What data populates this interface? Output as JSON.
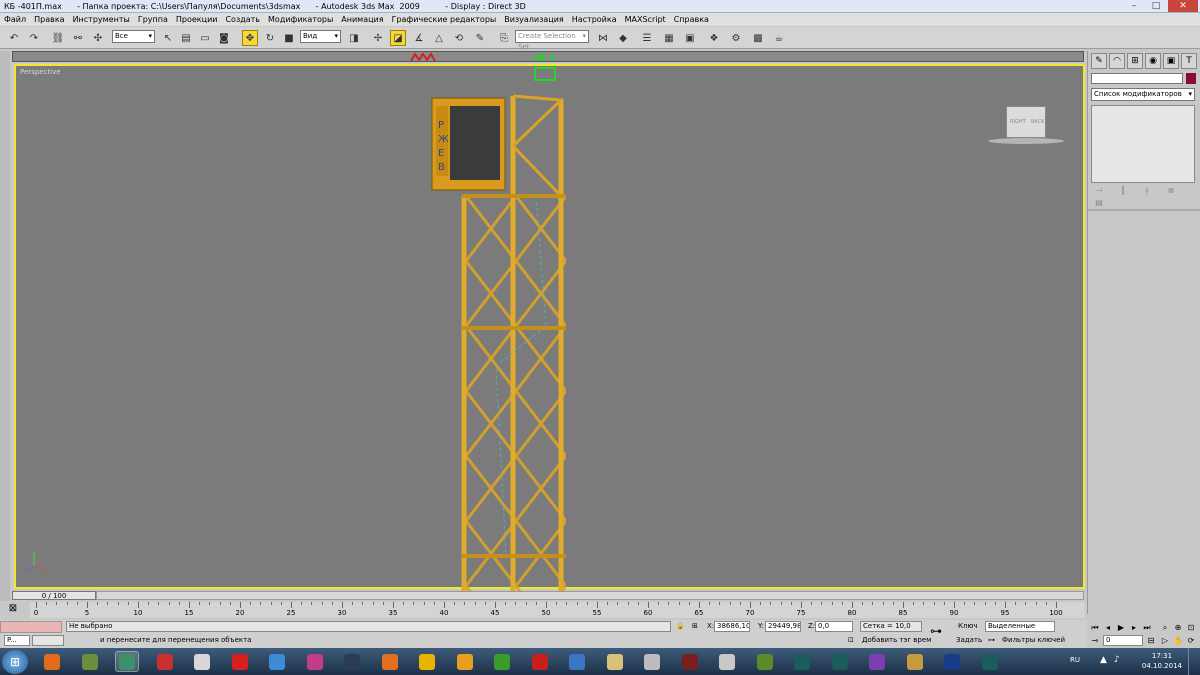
{
  "window": {
    "title": "КБ -401П.max      - Папка проекта: C:\\Users\\Папуля\\Documents\\3dsmax      - Autodesk 3ds Max  2009          - Display : Direct 3D",
    "min": "–",
    "max": "□",
    "close": "✕"
  },
  "menu": [
    "Файл",
    "Правка",
    "Инструменты",
    "Группа",
    "Проекции",
    "Создать",
    "Модификаторы",
    "Анимация",
    "Графические редакторы",
    "Визуализация",
    "Настройка",
    "MAXScript",
    "Справка"
  ],
  "toolbar": {
    "filter_select": "Все",
    "coord_select": "Вид",
    "selection_set": "Create Selection Set"
  },
  "viewport": {
    "label": "Perspective",
    "viewcube_right": "RIGHT",
    "viewcube_back": "BACK",
    "cabin_sign": "РЖЕВ",
    "colors": {
      "crane": "#d9a326",
      "cabin": "#d99a1e",
      "background": "#7b7b7b",
      "border": "#f3e82c"
    }
  },
  "right_panel": {
    "modifier_list": "Список модификаторов",
    "object_color": "#8a0c2e"
  },
  "timeline": {
    "slider": "0 / 100",
    "ticks": [
      "0",
      "5",
      "10",
      "15",
      "20",
      "25",
      "30",
      "35",
      "40",
      "45",
      "50",
      "55",
      "60",
      "65",
      "70",
      "75",
      "80",
      "85",
      "90",
      "95",
      "100"
    ]
  },
  "status": {
    "selection": "Не выбрано",
    "prompt": "и перенесите для перенещения объекта",
    "x_label": "X:",
    "x_value": "38686,109",
    "y_label": "Y:",
    "y_value": "29449,986",
    "z_label": "Z:",
    "z_value": "0,0",
    "grid": "Сетка = 10,0",
    "add_tag": "Добавить тэг врем",
    "key_label": "Ключ",
    "key_select": "Выделенные",
    "set_label": "Задать",
    "key_filters": "Фильтры ключей",
    "frame": "0",
    "mini_listener": "P..."
  },
  "taskbar": {
    "lang": "RU",
    "time": "17:31",
    "date": "04.10.2014",
    "apps": [
      "firefox-icon",
      "app-icon",
      "sketchbook-icon",
      "sketchup-icon",
      "box-icon",
      "red-dot-icon",
      "chrome-icon",
      "winrar-icon",
      "steam-icon",
      "orange-icon",
      "triangle-icon",
      "puzzle-icon",
      "utorrent-icon",
      "record-icon",
      "arrow-icon",
      "folder-icon",
      "gamepad-icon",
      "app2-icon",
      "calc-icon",
      "minecraft-icon",
      "3dsmax-icon",
      "3dsmax2-icon",
      "vs-icon",
      "radiation-icon",
      "photoshop-icon",
      "3dsmax3-icon"
    ]
  }
}
